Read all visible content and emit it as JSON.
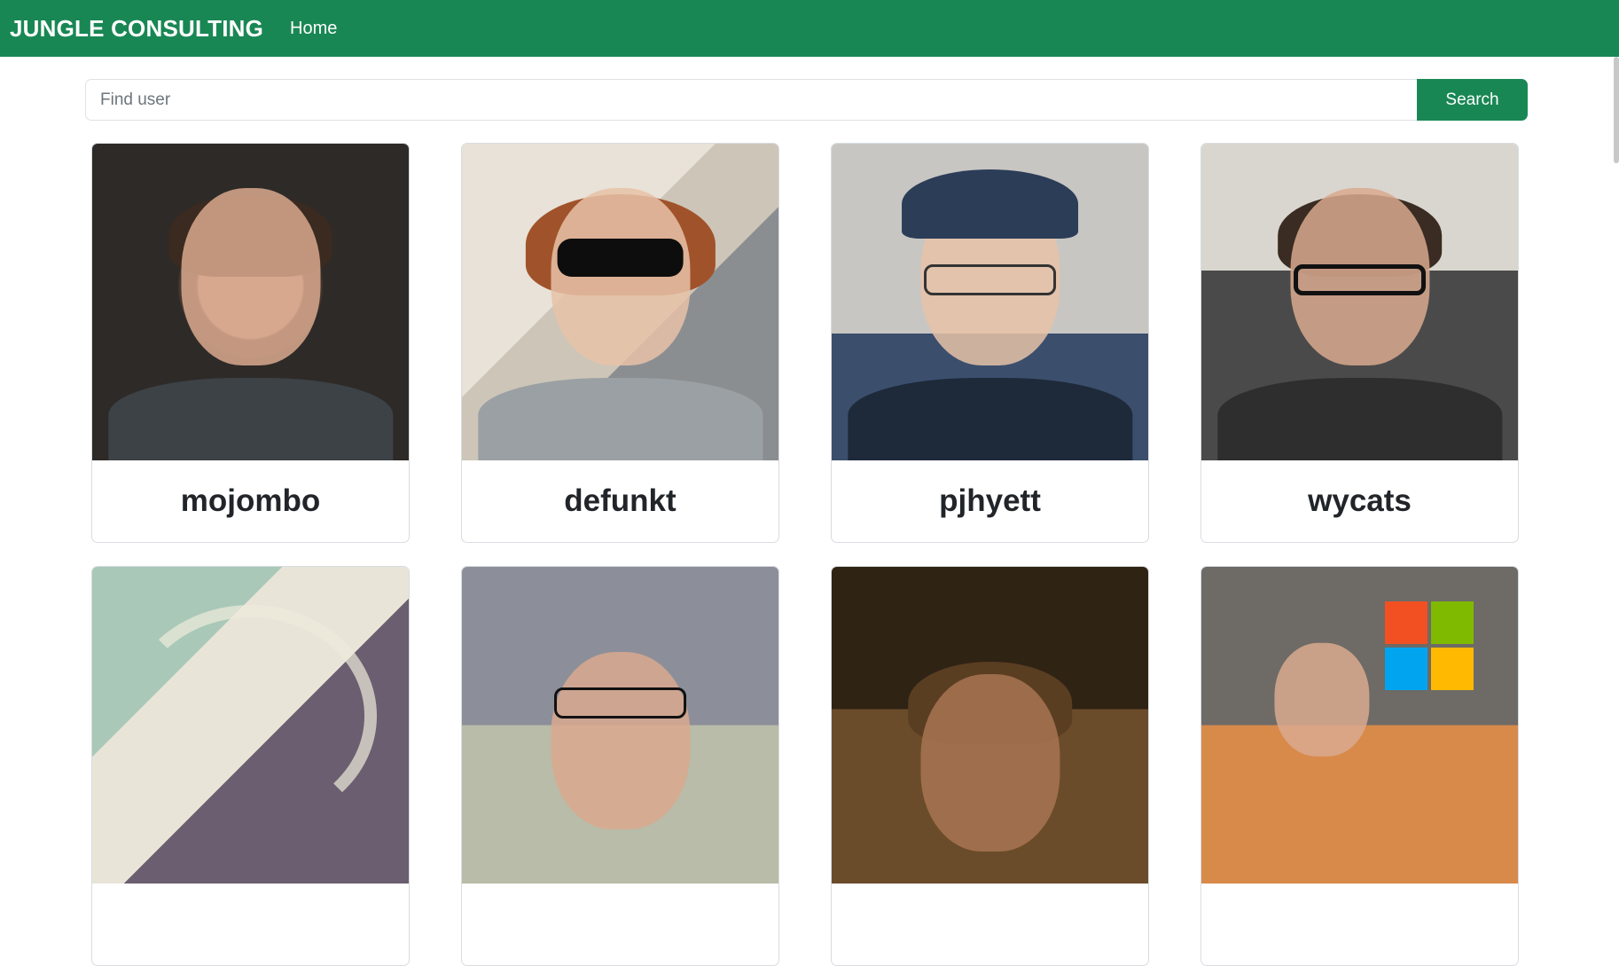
{
  "navbar": {
    "brand": "JUNGLE CONSULTING",
    "links": [
      "Home"
    ]
  },
  "search": {
    "placeholder": "Find user",
    "value": "",
    "button_label": "Search"
  },
  "users": [
    {
      "login": "mojombo"
    },
    {
      "login": "defunkt"
    },
    {
      "login": "pjhyett"
    },
    {
      "login": "wycats"
    },
    {
      "login": ""
    },
    {
      "login": ""
    },
    {
      "login": ""
    },
    {
      "login": ""
    }
  ],
  "colors": {
    "brand": "#198754",
    "text": "#212529",
    "border": "#dee2e6"
  }
}
